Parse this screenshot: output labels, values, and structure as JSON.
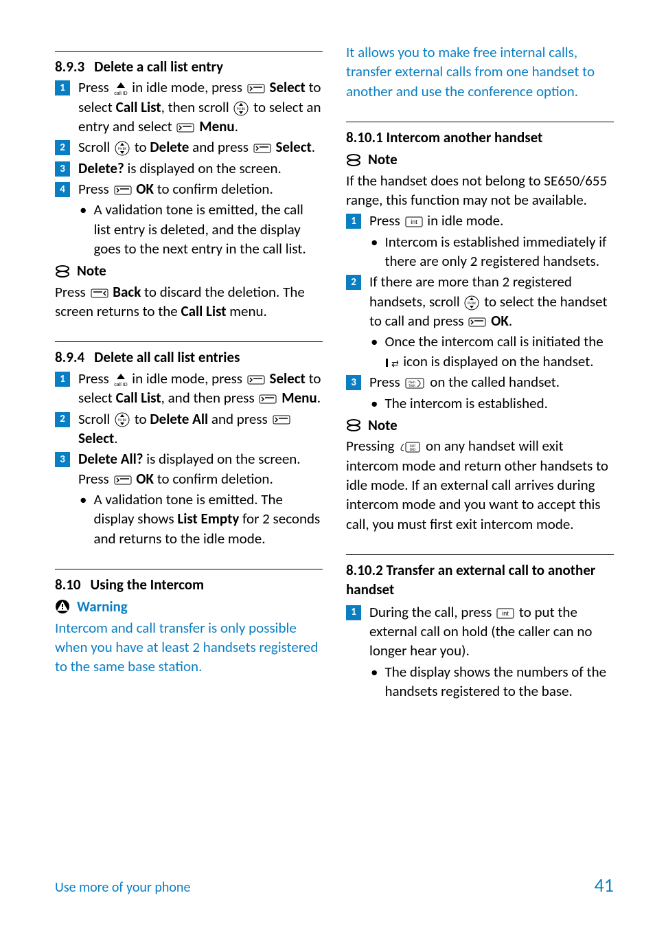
{
  "left": {
    "s893": {
      "num": "8.9.3",
      "title": "Delete a call list entry",
      "step1_a": "Press ",
      "step1_b": " in idle mode, press ",
      "step1_c": "Select",
      "step1_d": " to select ",
      "step1_e": "Call List",
      "step1_f": ", then scroll ",
      "step1_g": " to select an entry and select ",
      "step1_h": "Menu",
      "step1_i": ".",
      "step2_a": "Scroll ",
      "step2_b": " to ",
      "step2_c": "Delete",
      "step2_d": " and press ",
      "step2_e": "Select",
      "step2_f": ".",
      "step3_a": "Delete?",
      "step3_b": " is displayed on the screen.",
      "step4_a": "Press ",
      "step4_b": "OK",
      "step4_c": " to confirm deletion.",
      "bullet": "A validation tone is emitted, the call list entry is deleted, and the display goes to the next entry in the call list.",
      "note_label": "Note",
      "note_a": "Press ",
      "note_b": "Back",
      "note_c": " to discard the deletion. The screen returns to the ",
      "note_d": "Call List",
      "note_e": " menu."
    },
    "s894": {
      "num": "8.9.4",
      "title": "Delete all call list entries",
      "step1_a": "Press ",
      "step1_b": " in idle mode, press ",
      "step1_c": "Select",
      "step1_d": " to select ",
      "step1_e": "Call List",
      "step1_f": ", and then press ",
      "step1_g": "Menu",
      "step1_h": ".",
      "step2_a": "Scroll ",
      "step2_b": " to ",
      "step2_c": "Delete All",
      "step2_d": " and press ",
      "step2_e": "Select",
      "step2_f": ".",
      "step3_a": "Delete All?",
      "step3_b": " is displayed on the screen. Press ",
      "step3_c": "OK",
      "step3_d": " to confirm deletion.",
      "bullet_a": "A validation tone is emitted. The display shows ",
      "bullet_b": "List Empty",
      "bullet_c": " for 2 seconds and returns to the idle mode."
    },
    "s810": {
      "num": "8.10",
      "title": "Using the Intercom",
      "warn_label": "Warning",
      "warn_body": "Intercom and call transfer is only possible when you have at least 2 handsets registered to the same base station."
    }
  },
  "right": {
    "intro": "It allows you to make free internal calls, transfer external calls from one handset to another and use the conference option.",
    "s8101": {
      "title": "8.10.1 Intercom another handset",
      "note_label": "Note",
      "note_body": "If the handset does not belong to SE650/655 range, this function may not be available.",
      "step1_a": "Press ",
      "step1_b": " in idle mode.",
      "bullet1": "Intercom is established immediately if there are only 2 registered handsets.",
      "step2_a": "If there are more than 2 registered handsets, scroll ",
      "step2_b": " to select the handset to call and press ",
      "step2_c": "OK",
      "step2_d": ".",
      "bullet2_a": "Once the intercom call is initiated the ",
      "bullet2_b": " icon is displayed on the handset.",
      "step3_a": "Press ",
      "step3_b": " on the called handset.",
      "bullet3": "The intercom is established.",
      "note2_label": "Note",
      "note2_a": "Pressing ",
      "note2_b": " on any handset will exit intercom mode and return other handsets to idle mode. If an external call arrives during intercom mode and you want to accept this call, you must first exit intercom mode."
    },
    "s8102": {
      "title": "8.10.2 Transfer an external call to another handset",
      "step1_a": "During the call, press ",
      "step1_b": " to put the external call on hold (the caller can no longer hear you).",
      "bullet": "The display shows the numbers of the handsets registered to the base."
    }
  },
  "footer": {
    "left": "Use more of your phone",
    "right": "41"
  }
}
